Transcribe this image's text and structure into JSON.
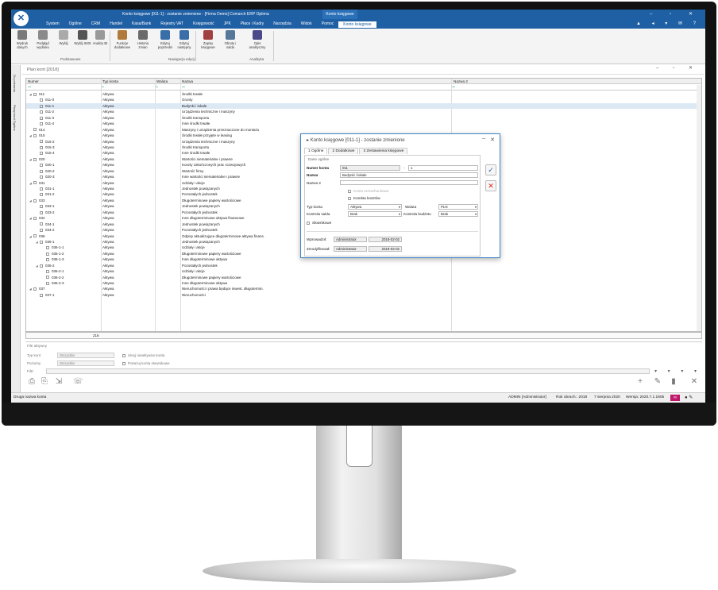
{
  "titlebar": {
    "title": "Konto księgowe [011-1] - zostanie zmienione - [Firma Demo] Comarch ERP Optima",
    "context_tab": "Konto księgowe"
  },
  "menu": [
    "System",
    "Ogólne",
    "CRM",
    "Handel",
    "Kasa/Bank",
    "Rejestry VAT",
    "Księgowość",
    "JPK",
    "Płace i Kadry",
    "Narzędzia",
    "Widok",
    "Pomoc",
    "Konto księgowe"
  ],
  "ribbon": {
    "buttons": [
      {
        "label": "Wydruk danych",
        "color": "#7a7a7a"
      },
      {
        "label": "Podgląd wydruku",
        "color": "#8a8a8a"
      },
      {
        "label": "Wyślij",
        "color": "#aaaaaa"
      },
      {
        "label": "Wyślij SMS",
        "color": "#555555"
      },
      {
        "label": "Analizy BI",
        "color": "#999999"
      },
      {
        "label": "Funkcje dodatkowe",
        "color": "#b07a3a"
      },
      {
        "label": "Historia zmian",
        "color": "#6a6a6a"
      },
      {
        "label": "Edytuj poprzedni",
        "color": "#3a6ea8"
      },
      {
        "label": "Edytuj następny",
        "color": "#3a6ea8"
      },
      {
        "label": "Zapisy księgowe",
        "color": "#a04040"
      },
      {
        "label": "Obroty i salda",
        "color": "#557799"
      },
      {
        "label": "Opis analityczny",
        "color": "#4a4a8a"
      }
    ],
    "groups": [
      "Podstawowe",
      "Nawigacja edycji",
      "Analityka"
    ]
  },
  "left_strip": [
    "Do pobrania",
    "Plany kont Ogólne"
  ],
  "list": {
    "title": "Plan kont [2018]",
    "columns": [
      "Numer",
      "Typ konta",
      "Waluta",
      "Nazwa",
      "Nazwa 2"
    ],
    "rows": [
      {
        "num": "011",
        "type": "Aktywa",
        "name": "Środki trwałe",
        "level": 0,
        "exp": "◢"
      },
      {
        "num": "011-0",
        "type": "Aktywa",
        "name": "Grunty",
        "level": 1,
        "exp": ""
      },
      {
        "num": "011-1",
        "type": "Aktywa",
        "name": "Budynki i lokale",
        "level": 1,
        "exp": "",
        "sel": true
      },
      {
        "num": "011-2",
        "type": "Aktywa",
        "name": "Urządzenia techniczne i maszyny",
        "level": 1,
        "exp": ""
      },
      {
        "num": "011-3",
        "type": "Aktywa",
        "name": "Środki transportu",
        "level": 1,
        "exp": ""
      },
      {
        "num": "011-4",
        "type": "Aktywa",
        "name": "Inne środki trwałe",
        "level": 1,
        "exp": ""
      },
      {
        "num": "014",
        "type": "Aktywa",
        "name": "Maszyny i urządzenia przeznaczone do montażu",
        "level": 0,
        "exp": ""
      },
      {
        "num": "015",
        "type": "Aktywa",
        "name": "Środki trwałe przyjęte w leasing",
        "level": 0,
        "exp": "◢"
      },
      {
        "num": "015-2",
        "type": "Aktywa",
        "name": "Urządzenia techniczne i maszyny",
        "level": 1,
        "exp": ""
      },
      {
        "num": "015-3",
        "type": "Aktywa",
        "name": "Środki transportu",
        "level": 1,
        "exp": ""
      },
      {
        "num": "015-4",
        "type": "Aktywa",
        "name": "Inne środki trwałe",
        "level": 1,
        "exp": ""
      },
      {
        "num": "020",
        "type": "Aktywa",
        "name": "Wartości niematerialne i prawne",
        "level": 0,
        "exp": "◢"
      },
      {
        "num": "020-1",
        "type": "Aktywa",
        "name": "Koszty zakończonych prac rozwojowych",
        "level": 1,
        "exp": ""
      },
      {
        "num": "020-2",
        "type": "Aktywa",
        "name": "Wartość firmy",
        "level": 1,
        "exp": ""
      },
      {
        "num": "020-3",
        "type": "Aktywa",
        "name": "Inne wartości niematerialne i prawne",
        "level": 1,
        "exp": ""
      },
      {
        "num": "031",
        "type": "Aktywa",
        "name": "Udziały i akcje",
        "level": 0,
        "exp": "◢"
      },
      {
        "num": "031-1",
        "type": "Aktywa",
        "name": "Jednostek powiązanych",
        "level": 1,
        "exp": ""
      },
      {
        "num": "031-2",
        "type": "Aktywa",
        "name": "Pozostałych jednostek",
        "level": 1,
        "exp": ""
      },
      {
        "num": "033",
        "type": "Aktywa",
        "name": "Długoterminowe papiery wartościowe",
        "level": 0,
        "exp": "◢"
      },
      {
        "num": "033-1",
        "type": "Aktywa",
        "name": "Jednostek powiązanych",
        "level": 1,
        "exp": ""
      },
      {
        "num": "033-2",
        "type": "Aktywa",
        "name": "Pozostałych jednostek",
        "level": 1,
        "exp": ""
      },
      {
        "num": "034",
        "type": "Aktywa",
        "name": "Inne długoterminowe aktywa finansowe",
        "level": 0,
        "exp": "◢"
      },
      {
        "num": "034-1",
        "type": "Aktywa",
        "name": "Jednostek powiązanych",
        "level": 1,
        "exp": ""
      },
      {
        "num": "034-2",
        "type": "Aktywa",
        "name": "Pozostałych jednostek",
        "level": 1,
        "exp": ""
      },
      {
        "num": "036",
        "type": "Aktywa",
        "name": "Odpisy aktualizujące długoterminowe aktywa finans.",
        "level": 0,
        "exp": "◢"
      },
      {
        "num": "036-1",
        "type": "Aktywa",
        "name": "Jednostek powiązanych",
        "level": 1,
        "exp": "◢"
      },
      {
        "num": "036-1-1",
        "type": "Aktywa",
        "name": "Udziały i akcje",
        "level": 2,
        "exp": ""
      },
      {
        "num": "036-1-2",
        "type": "Aktywa",
        "name": "Długoterminowe papiery wartościowe",
        "level": 2,
        "exp": ""
      },
      {
        "num": "036-1-3",
        "type": "Aktywa",
        "name": "Inne długoterminowe aktywa",
        "level": 2,
        "exp": ""
      },
      {
        "num": "036-2",
        "type": "Aktywa",
        "name": "Pozostałych jednostek",
        "level": 1,
        "exp": "◢"
      },
      {
        "num": "036-2-1",
        "type": "Aktywa",
        "name": "Udziały i akcje",
        "level": 2,
        "exp": ""
      },
      {
        "num": "036-2-2",
        "type": "Aktywa",
        "name": "Długoterminowe papiery wartościowe",
        "level": 2,
        "exp": ""
      },
      {
        "num": "036-2-3",
        "type": "Aktywa",
        "name": "Inne długoterminowe aktywa",
        "level": 2,
        "exp": ""
      },
      {
        "num": "037",
        "type": "Aktywa",
        "name": "Nieruchomości i prawa będące inwest. długotermin.",
        "level": 0,
        "exp": "◢"
      },
      {
        "num": "037-1",
        "type": "Aktywa",
        "name": "Nieruchomości",
        "level": 1,
        "exp": ""
      }
    ],
    "footer_count": "216"
  },
  "filters": {
    "title": "Filtr aktywny",
    "type_label": "Typ kont",
    "type_value": "Wszystkie",
    "level_label": "Poziomy",
    "level_value": "Wszystkie",
    "hide_inactive": "Ukryj nieaktywne konta",
    "show_offbalance": "Pokazuj konta słownikowe",
    "filter_label": "Filtr:"
  },
  "status": {
    "left": "Druga nazwa konta",
    "user": "ADMIN [Administrator]",
    "year": "Rok obrach.: 2018",
    "date": "7 sierpnia 2020",
    "version": "Wersja: 2020.7.1.1805"
  },
  "dialog": {
    "title": "Konto księgowe [011-1] - zostanie zmienione",
    "tabs": [
      "1 Ogólne",
      "2 Dodatkowe",
      "3 Zestawienia księgowe"
    ],
    "section": "Dane ogólne",
    "numer_label": "Numer konta",
    "numer_a": "011",
    "numer_sep": "-",
    "numer_b": "1",
    "nazwa_label": "Nazwa",
    "nazwa_value": "Budynki i lokale",
    "nazwa2_label": "Nazwa 2",
    "nazwa2_value": "",
    "rozrach": "Konto rozrachunkowe",
    "korekta": "Korekta kosztów",
    "typ_label": "Typ konta",
    "typ_value": "Aktywa",
    "waluta_label": "Waluta",
    "waluta_value": "PLN",
    "kontrola_label": "Kontrola salda",
    "kontrola_value": "Brak",
    "budzet_label": "Kontrola budżetu",
    "budzet_value": "Brak",
    "slownikowe": "Słownikowe",
    "wprow_label": "Wprowadził:",
    "wprow_user": "Administrator",
    "wprow_date": "2018-02-02",
    "zmod_label": "Zmodyfikował:",
    "zmod_user": "Administrator",
    "zmod_date": "2018-02-02",
    "save_icon": "save-icon",
    "cancel_icon": "cancel-icon"
  }
}
